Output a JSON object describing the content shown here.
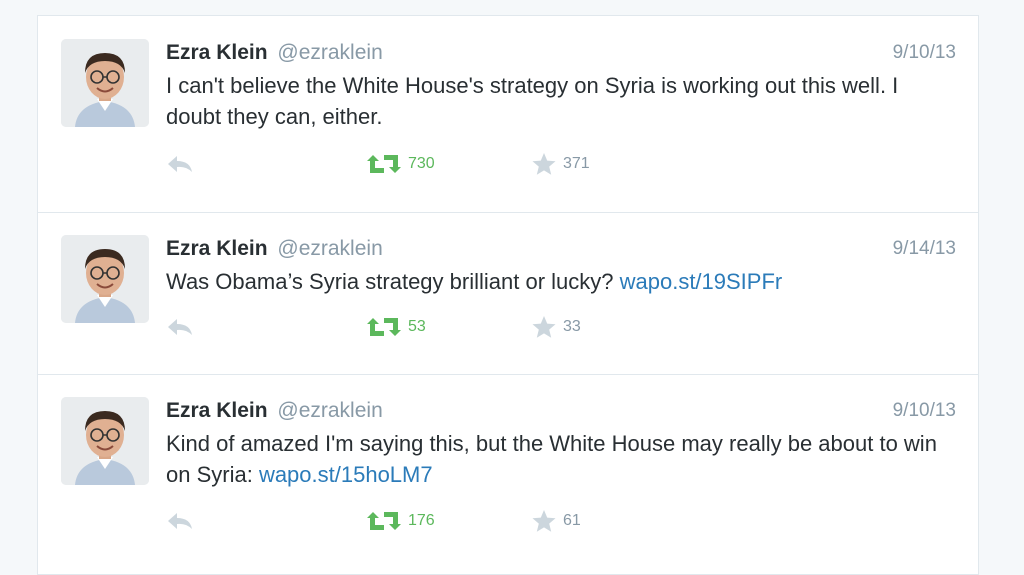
{
  "tweets": [
    {
      "name": "Ezra Klein",
      "handle": "@ezraklein",
      "date": "9/10/13",
      "text": "I can't believe the White House's strategy on Syria is working out this well. I doubt they can, either.",
      "link": "",
      "retweets": "730",
      "favorites": "371"
    },
    {
      "name": "Ezra Klein",
      "handle": "@ezraklein",
      "date": "9/14/13",
      "text": "Was Obama’s Syria strategy brilliant or lucky? ",
      "link": "wapo.st/19SIPFr",
      "retweets": "53",
      "favorites": "33"
    },
    {
      "name": "Ezra Klein",
      "handle": "@ezraklein",
      "date": "9/10/13",
      "text": "Kind of amazed I'm saying this, but the White House may really be about to win on Syria: ",
      "link": "wapo.st/15hoLM7",
      "retweets": "176",
      "favorites": "61"
    }
  ],
  "colors": {
    "retweet_green": "#5cb85c",
    "link_blue": "#2b7bb9",
    "muted_gray": "#8899a6",
    "icon_gray": "#ccd6dd"
  },
  "icons": {
    "reply": "reply-icon",
    "retweet": "retweet-icon",
    "favorite": "star-icon"
  }
}
